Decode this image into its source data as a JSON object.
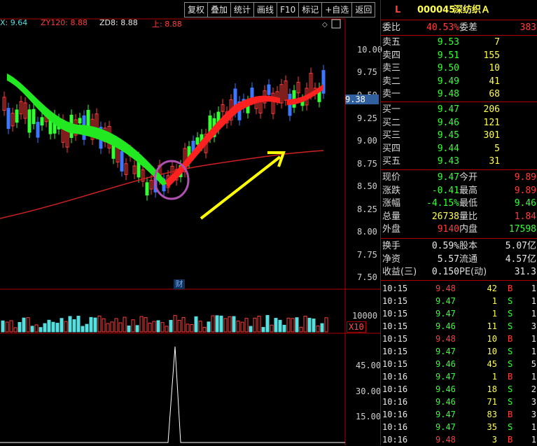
{
  "toolbar": [
    "复权",
    "叠加",
    "统计",
    "画线",
    "F10",
    "标记",
    "+自选",
    "返回"
  ],
  "indicators": {
    "first": "X: 9.64",
    "zy120": "ZY120: 8.88",
    "zd8": "ZD8: 8.88",
    "shang": "上: 8.88"
  },
  "chart": {
    "price_axis": [
      "10.00",
      "9.75",
      "9.50",
      "9.25",
      "9.00",
      "8.75",
      "8.50",
      "8.25",
      "8.00",
      "7.75",
      "7.50"
    ],
    "current_price_tag": "9.38",
    "cai_label": "财",
    "volume_axis": "10000",
    "volume_multiplier": "X10",
    "indicator_axis": [
      "45.00",
      "30.00",
      "15.00"
    ]
  },
  "stock": {
    "market": "L",
    "code": "000045",
    "name": "深纺织Ａ"
  },
  "order_book": {
    "weibi_label": "委比",
    "weibi": "40.53%",
    "weicha_label": "委差",
    "weicha": "383",
    "asks": [
      {
        "label": "卖五",
        "price": "9.53",
        "vol": "7"
      },
      {
        "label": "卖四",
        "price": "9.51",
        "vol": "155"
      },
      {
        "label": "卖三",
        "price": "9.50",
        "vol": "10"
      },
      {
        "label": "卖二",
        "price": "9.49",
        "vol": "41"
      },
      {
        "label": "卖一",
        "price": "9.48",
        "vol": "68"
      }
    ],
    "bids": [
      {
        "label": "买一",
        "price": "9.47",
        "vol": "206"
      },
      {
        "label": "买二",
        "price": "9.46",
        "vol": "121"
      },
      {
        "label": "买三",
        "price": "9.45",
        "vol": "301"
      },
      {
        "label": "买四",
        "price": "9.44",
        "vol": "5"
      },
      {
        "label": "买五",
        "price": "9.43",
        "vol": "31"
      }
    ]
  },
  "quote": [
    {
      "l1": "现价",
      "v1": "9.47",
      "l2": "今开",
      "v2": "9.89",
      "c1": "green",
      "c2": "red"
    },
    {
      "l1": "涨跌",
      "v1": "-0.41",
      "l2": "最高",
      "v2": "9.89",
      "c1": "green",
      "c2": "red"
    },
    {
      "l1": "涨幅",
      "v1": "-4.15%",
      "l2": "最低",
      "v2": "9.46",
      "c1": "green",
      "c2": "green"
    },
    {
      "l1": "总量",
      "v1": "26738",
      "l2": "量比",
      "v2": "1.84",
      "c1": "yellow",
      "c2": "red"
    },
    {
      "l1": "外盘",
      "v1": "9140",
      "l2": "内盘",
      "v2": "17598",
      "c1": "red",
      "c2": "green"
    }
  ],
  "fundamentals": [
    {
      "l1": "换手",
      "v1": "0.59%",
      "l2": "股本",
      "v2": "5.07亿"
    },
    {
      "l1": "净资",
      "v1": "5.57",
      "l2": "流通",
      "v2": "4.57亿"
    },
    {
      "l1": "收益(三)",
      "v1": "0.150",
      "l2": "PE(动)",
      "v2": "31.3"
    }
  ],
  "ticks": [
    {
      "t": "10:15",
      "p": "9.48",
      "v": "42",
      "d": "B",
      "n": "1"
    },
    {
      "t": "10:15",
      "p": "9.47",
      "v": "1",
      "d": "S",
      "n": "1"
    },
    {
      "t": "10:15",
      "p": "9.47",
      "v": "1",
      "d": "S",
      "n": "1"
    },
    {
      "t": "10:15",
      "p": "9.46",
      "v": "11",
      "d": "S",
      "n": "3"
    },
    {
      "t": "10:15",
      "p": "9.48",
      "v": "10",
      "d": "B",
      "n": "1"
    },
    {
      "t": "10:15",
      "p": "9.47",
      "v": "10",
      "d": "S",
      "n": "1"
    },
    {
      "t": "10:15",
      "p": "9.46",
      "v": "45",
      "d": "S",
      "n": "5"
    },
    {
      "t": "10:16",
      "p": "9.47",
      "v": "1",
      "d": "B",
      "n": "1"
    },
    {
      "t": "10:16",
      "p": "9.46",
      "v": "18",
      "d": "S",
      "n": "2"
    },
    {
      "t": "10:16",
      "p": "9.46",
      "v": "71",
      "d": "S",
      "n": "3"
    },
    {
      "t": "10:16",
      "p": "9.47",
      "v": "83",
      "d": "B",
      "n": "3"
    },
    {
      "t": "10:16",
      "p": "9.47",
      "v": "35",
      "d": "S",
      "n": "1"
    },
    {
      "t": "10:16",
      "p": "9.48",
      "v": "3",
      "d": "B",
      "n": "1"
    }
  ],
  "colors": {
    "up": "#ff3c3c",
    "down": "#33ff33",
    "frame": "#b00000",
    "volume": "#57dede"
  }
}
